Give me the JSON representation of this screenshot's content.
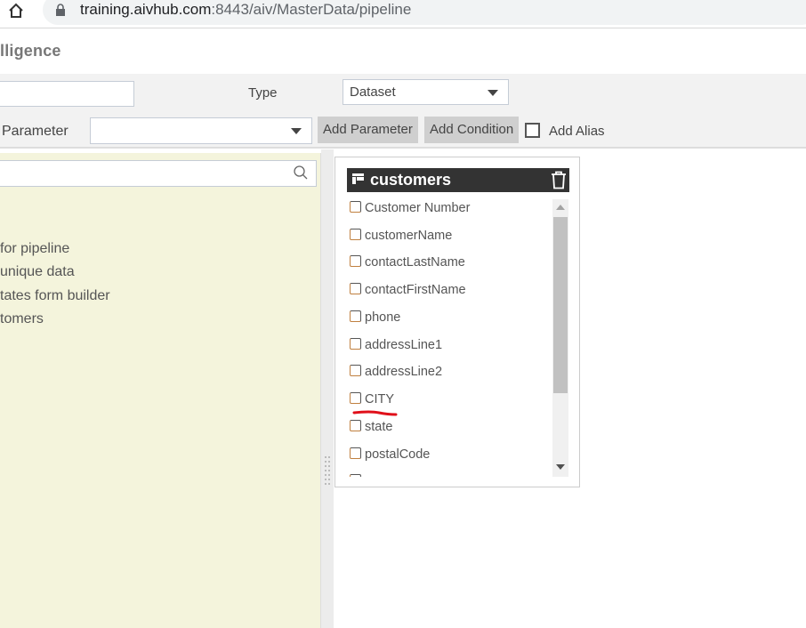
{
  "browser": {
    "url_host": "training.aivhub.com",
    "url_rest": ":8443/aiv/MasterData/pipeline",
    "icons": [
      "home-icon",
      "lock-icon"
    ]
  },
  "app": {
    "title_fragment": "lligence"
  },
  "toolbar": {
    "type_label": "Type",
    "type_value": "Dataset",
    "parameter_label": "Parameter",
    "parameter_value": "",
    "add_parameter": "Add Parameter",
    "add_condition": "Add Condition",
    "add_alias": "Add Alias",
    "add_alias_checked": false
  },
  "left_panel": {
    "search_placeholder": "",
    "items": [
      "for pipeline",
      "unique data",
      "tates form builder",
      "tomers"
    ]
  },
  "card": {
    "title": "customers",
    "icons": [
      "table-icon",
      "trash-icon"
    ],
    "fields": [
      {
        "label": "Customer Number",
        "checked": false
      },
      {
        "label": "customerName",
        "checked": false
      },
      {
        "label": "contactLastName",
        "checked": false
      },
      {
        "label": "contactFirstName",
        "checked": false
      },
      {
        "label": "phone",
        "checked": false
      },
      {
        "label": "addressLine1",
        "checked": false
      },
      {
        "label": "addressLine2",
        "checked": false
      },
      {
        "label": "CITY",
        "checked": false,
        "annotation": "red underline"
      },
      {
        "label": "state",
        "checked": false
      },
      {
        "label": "postalCode",
        "checked": false
      }
    ]
  },
  "colors": {
    "card_header": "#333333",
    "left_panel_bg": "#f4f4dc",
    "button_bg": "#cfcfcf",
    "annotation": "#e0101a"
  }
}
